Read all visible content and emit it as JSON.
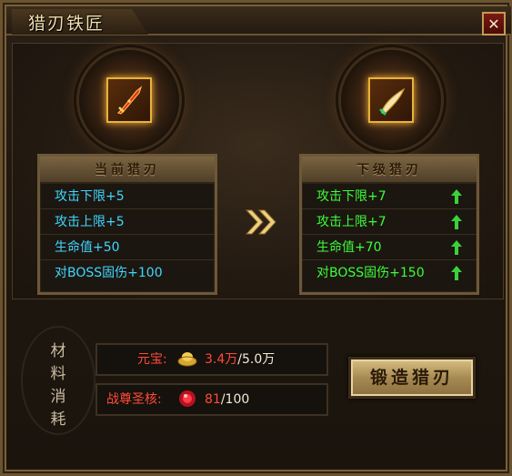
{
  "window": {
    "title": "猎刃铁匠",
    "close_symbol": "✕"
  },
  "current": {
    "header": "当前猎刃",
    "icon": "red-blade-icon",
    "stats": [
      "攻击下限+5",
      "攻击上限+5",
      "生命值+50",
      "对BOSS固伤+100"
    ]
  },
  "next": {
    "header": "下级猎刃",
    "icon": "gold-blade-icon",
    "stats": [
      "攻击下限+7",
      "攻击上限+7",
      "生命值+70",
      "对BOSS固伤+150"
    ]
  },
  "materials": {
    "label_chars": [
      "材",
      "料",
      "消",
      "耗"
    ],
    "items": [
      {
        "name": "元宝:",
        "icon": "gold-ingot-icon",
        "have": "3.4万",
        "need": "/5.0万"
      },
      {
        "name": "战尊圣核:",
        "icon": "red-gem-icon",
        "have": "81",
        "need": "/100"
      }
    ]
  },
  "forge_button": "锻造猎刃",
  "colors": {
    "current_stat": "#3fd7ff",
    "next_stat": "#3aff3a",
    "cost": "#ff4a3a"
  }
}
